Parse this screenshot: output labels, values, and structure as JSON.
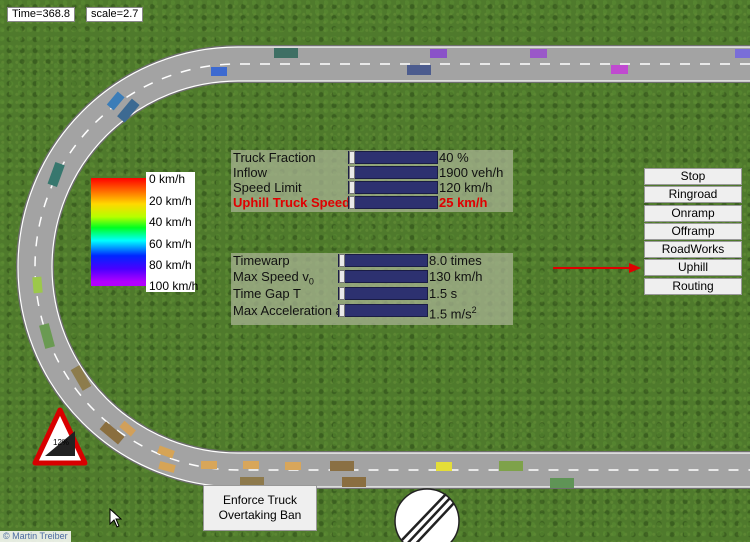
{
  "status": {
    "time": "Time=368.8",
    "scale": "scale=2.7"
  },
  "legend": {
    "labels": [
      "0 km/h",
      "20 km/h",
      "40 km/h",
      "60 km/h",
      "80 km/h",
      "100 km/h"
    ]
  },
  "traffic_sliders": [
    {
      "label": "Truck Fraction",
      "value": "40 %",
      "level": 0.0
    },
    {
      "label": "Inflow",
      "value": "1900 veh/h",
      "level": 0.0
    },
    {
      "label": "Speed Limit",
      "value": "120 km/h",
      "level": 0.0
    },
    {
      "label": "Uphill Truck Speed",
      "value": "25 km/h",
      "level": 0.0,
      "highlight": true
    }
  ],
  "model_sliders": [
    {
      "label": "Timewarp",
      "value": "8.0 times",
      "level": 0.0
    },
    {
      "label": "Max Speed v",
      "label_sub": "0",
      "value": "130 km/h",
      "level": 0.0
    },
    {
      "label": "Time Gap T",
      "value": "1.5 s",
      "level": 0.0
    },
    {
      "label": "Max Acceleration a",
      "value": "1.5 m/s",
      "value_sup": "2",
      "level": 0.0
    }
  ],
  "scenario_buttons": [
    "Stop",
    "Ringroad",
    "Onramp",
    "Offramp",
    "RoadWorks",
    "Uphill",
    "Routing"
  ],
  "overtaking_ban_button": {
    "line1": "Enforce Truck",
    "line2": "Overtaking Ban"
  },
  "grade_sign": "12%",
  "copyright": "© Martin Treiber",
  "colors": {
    "panel": "#aab496",
    "slider_bar": "#2d3170",
    "highlight": "#e00000",
    "arrow": "#e00000",
    "road": "#9b9b9b",
    "grass": "#4f7a2c"
  }
}
